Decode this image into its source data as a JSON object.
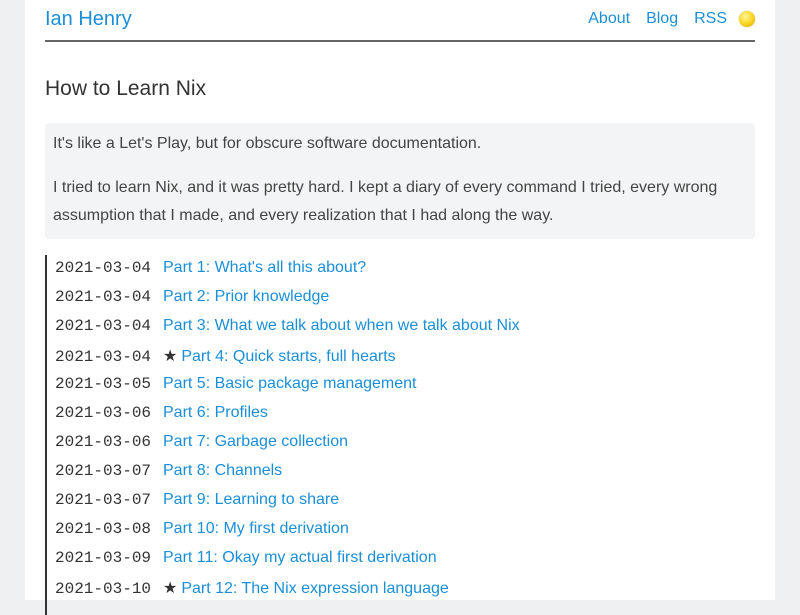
{
  "header": {
    "site_title": "Ian Henry",
    "nav": [
      {
        "label": "About"
      },
      {
        "label": "Blog"
      },
      {
        "label": "RSS"
      }
    ]
  },
  "main": {
    "title": "How to Learn Nix",
    "intro": [
      "It's like a Let's Play, but for obscure software documentation.",
      "I tried to learn Nix, and it was pretty hard. I kept a diary of every command I tried, every wrong assumption that I made, and every realization that I had along the way."
    ],
    "posts": [
      {
        "date": "2021-03-04",
        "title": "Part 1: What's all this about?",
        "starred": false
      },
      {
        "date": "2021-03-04",
        "title": "Part 2: Prior knowledge",
        "starred": false
      },
      {
        "date": "2021-03-04",
        "title": "Part 3: What we talk about when we talk about Nix",
        "starred": false
      },
      {
        "date": "2021-03-04",
        "title": "Part 4: Quick starts, full hearts",
        "starred": true
      },
      {
        "date": "2021-03-05",
        "title": "Part 5: Basic package management",
        "starred": false
      },
      {
        "date": "2021-03-06",
        "title": "Part 6: Profiles",
        "starred": false
      },
      {
        "date": "2021-03-06",
        "title": "Part 7: Garbage collection",
        "starred": false
      },
      {
        "date": "2021-03-07",
        "title": "Part 8: Channels",
        "starred": false
      },
      {
        "date": "2021-03-07",
        "title": "Part 9: Learning to share",
        "starred": false
      },
      {
        "date": "2021-03-08",
        "title": "Part 10: My first derivation",
        "starred": false
      },
      {
        "date": "2021-03-09",
        "title": "Part 11: Okay my actual first derivation",
        "starred": false
      },
      {
        "date": "2021-03-10",
        "title": "Part 12: The Nix expression language",
        "starred": true
      }
    ],
    "star_glyph": "★"
  },
  "colors": {
    "link": "#1a8fd8",
    "text": "#333333",
    "intro_bg": "#f3f4f5",
    "page_bg": "#eef0f2"
  },
  "icons": {
    "theme_toggle": "sun-icon"
  }
}
